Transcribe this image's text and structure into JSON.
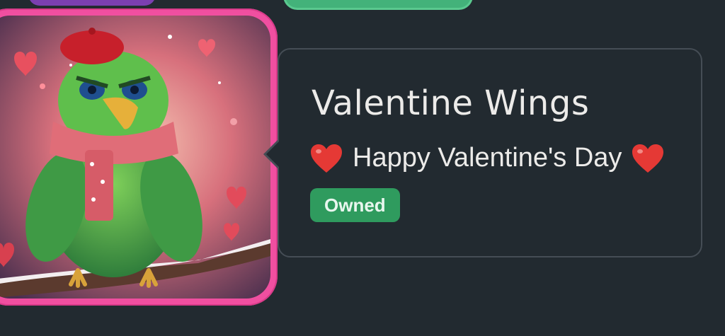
{
  "item": {
    "title": "Valentine Wings",
    "subtitle": "Happy Valentine's Day",
    "badge_label": "Owned"
  },
  "icons": {
    "heart_left": "red-heart-icon",
    "heart_right": "red-heart-icon"
  },
  "colors": {
    "background": "#222a30",
    "frame_pink": "#f04fa0",
    "badge_green": "#2f9b5e",
    "text": "#ecebe9",
    "heart": "#e53935"
  }
}
